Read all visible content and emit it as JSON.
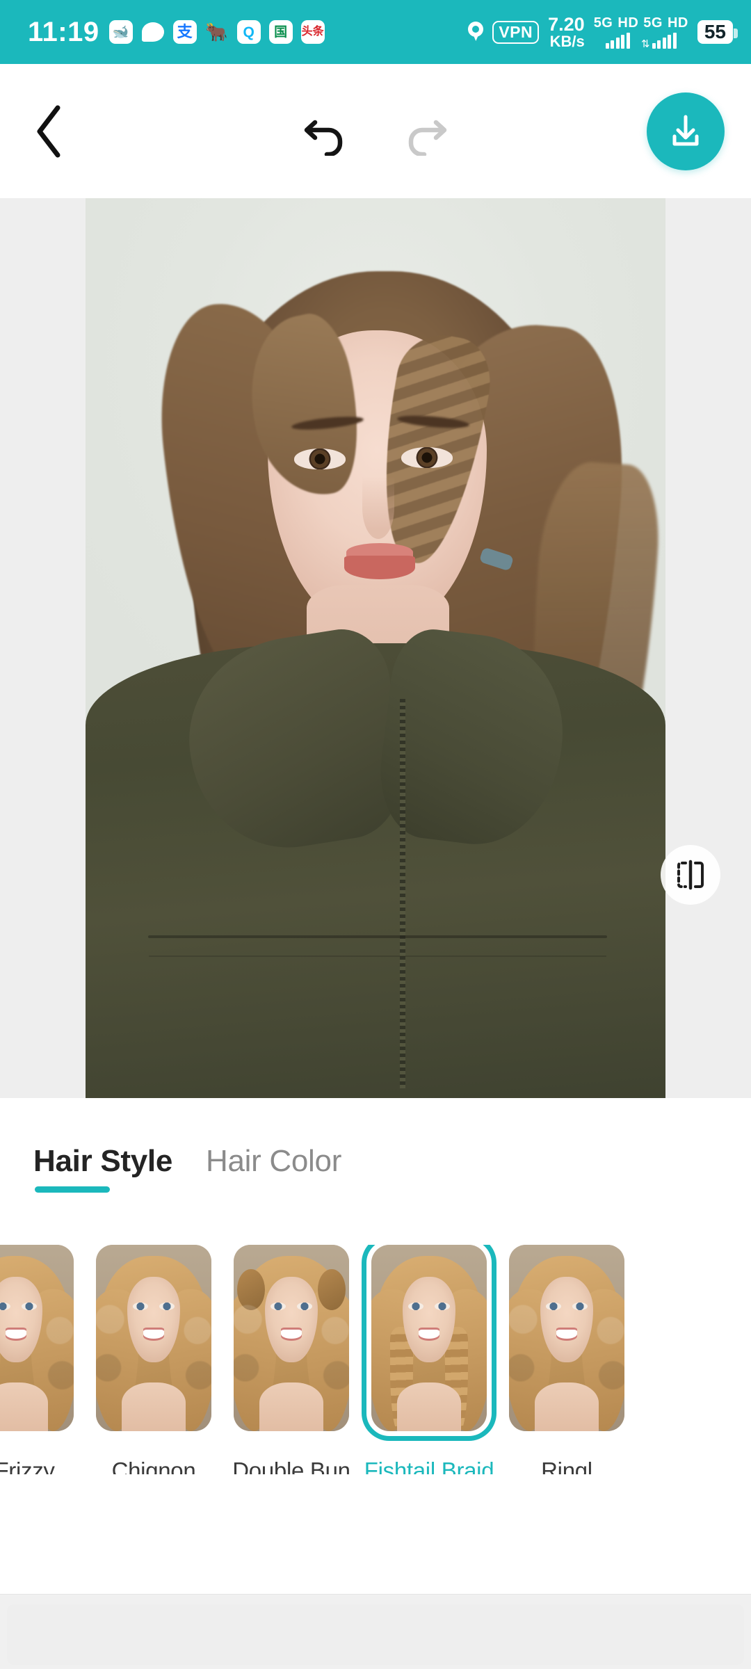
{
  "status_bar": {
    "time": "11:19",
    "app_icons": [
      {
        "name": "whale-app-icon",
        "glyph": "🐳"
      },
      {
        "name": "chat-bubble-icon",
        "glyph": ""
      },
      {
        "name": "alipay-icon",
        "glyph": "支"
      },
      {
        "name": "cow-app-icon",
        "glyph": "🐂"
      },
      {
        "name": "qq-icon",
        "glyph": "Q"
      },
      {
        "name": "nation-app-icon",
        "glyph": "国"
      },
      {
        "name": "toutiao-icon",
        "glyph": "头条"
      }
    ],
    "location_icon": "location-pin-icon",
    "vpn_label": "VPN",
    "net_speed_value": "7.20",
    "net_speed_unit": "KB/s",
    "sim1_network": "5G",
    "sim1_hd": "HD",
    "sim2_network": "5G",
    "sim2_hd": "HD",
    "battery_level": "55",
    "background_color": "#1BB8BC"
  },
  "toolbar": {
    "back_label": "back-button",
    "undo_label": "undo",
    "redo_label": "redo",
    "save_label": "download",
    "undo_enabled": "true",
    "redo_enabled": "false",
    "accent_color": "#1BB8BC"
  },
  "canvas": {
    "compare_button_label": "compare-before-after",
    "background_color": "#EEEEEE"
  },
  "panel": {
    "tabs": [
      {
        "label": "Hair Style",
        "active": true
      },
      {
        "label": "Hair Color",
        "active": false
      }
    ],
    "selected_tab": "Hair Style",
    "selected_style": "Fishtail Braid",
    "accent_color": "#1BB8BC",
    "styles": [
      {
        "label": "y Frizzy",
        "selected": false,
        "truncated": true
      },
      {
        "label": "Chignon",
        "selected": false,
        "truncated": false
      },
      {
        "label": "Double Bun",
        "selected": false,
        "truncated": false
      },
      {
        "label": "Fishtail Braid",
        "selected": true,
        "truncated": false
      },
      {
        "label": "Ringl",
        "selected": false,
        "truncated": true
      }
    ]
  }
}
